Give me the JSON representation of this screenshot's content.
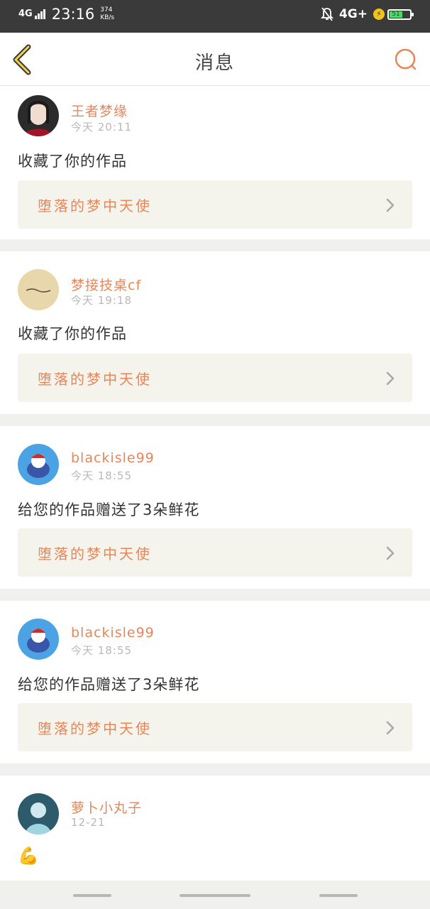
{
  "status_bar": {
    "network": "4G",
    "time": "23:16",
    "speed_value": "374",
    "speed_unit": "KB/s",
    "network_right": "4G+",
    "battery_level": "51"
  },
  "header": {
    "title": "消息",
    "back_icon": "chevron-left-icon",
    "search_icon": "search-icon",
    "accent_color": "#e8865a"
  },
  "messages": [
    {
      "user": "王者梦缘",
      "time": "今天 20:11",
      "action": "收藏了你的作品",
      "work": "堕落的梦中天使"
    },
    {
      "user": "梦接技桌cf",
      "time": "今天 19:18",
      "action": "收藏了你的作品",
      "work": "堕落的梦中天使"
    },
    {
      "user": "blackisle99",
      "time": "今天 18:55",
      "action": "给您的作品赠送了3朵鲜花",
      "work": "堕落的梦中天使"
    },
    {
      "user": "blackisle99",
      "time": "今天 18:55",
      "action": "给您的作品赠送了3朵鲜花",
      "work": "堕落的梦中天使"
    },
    {
      "user": "萝卜小丸子",
      "time": "12-21",
      "action": "💪"
    }
  ]
}
